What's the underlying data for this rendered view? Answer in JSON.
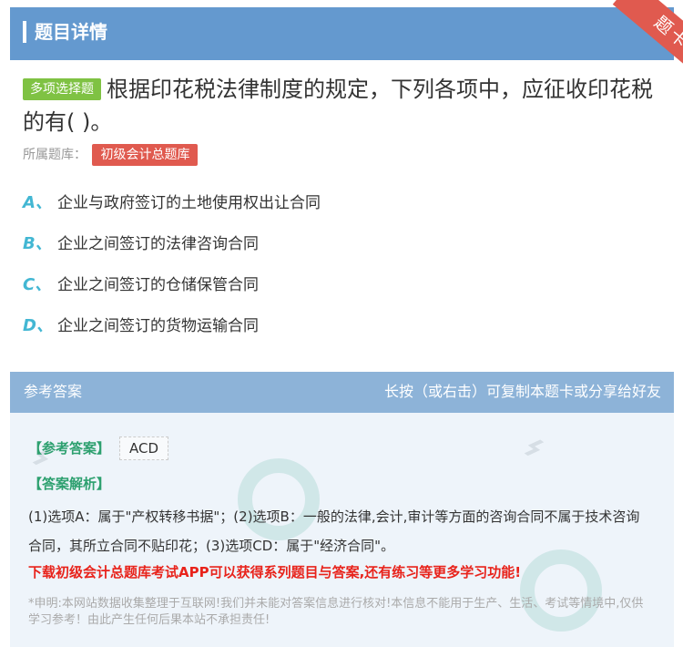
{
  "header": {
    "title": "题目详情"
  },
  "ribbon": {
    "label": "题卡"
  },
  "question": {
    "type_tag": "多项选择题",
    "text": "根据印花税法律制度的规定，下列各项中，应征收印花税的有( )。",
    "bank_label": "所属题库：",
    "bank_name": "初级会计总题库",
    "options": [
      {
        "letter": "A、",
        "text": "企业与政府签订的土地使用权出让合同"
      },
      {
        "letter": "B、",
        "text": "企业之间签订的法律咨询合同"
      },
      {
        "letter": "C、",
        "text": "企业之间签订的仓储保管合同"
      },
      {
        "letter": "D、",
        "text": "企业之间签订的货物运输合同"
      }
    ]
  },
  "answer": {
    "section_title": "参考答案",
    "copy_hint": "长按（或右击）可复制本题卡或分享给好友",
    "ref_label": "【参考答案】",
    "ref_value": "ACD",
    "analysis_label": "【答案解析】",
    "analysis_text": "(1)选项A：属于\"产权转移书据\"；(2)选项B：一般的法律,会计,审计等方面的咨询合同不属于技术咨询合同，其所立合同不贴印花；(3)选项CD：属于\"经济合同\"。",
    "promo": "下载初级会计总题库考试APP可以获得系列题目与答案,还有练习等更多学习功能!",
    "disclaimer": "*申明:本网站数据收集整理于互联网!我们并未能对答案信息进行核对!本信息不能用于生产、生活、考试等情境中,仅供学习参考！由此产生任何后果本站不承担责任!"
  },
  "colors": {
    "header_bg": "#6499cf",
    "ribbon_bg": "#e05a4f",
    "type_tag_bg": "#7fc243",
    "bank_badge_bg": "#e05a4f",
    "option_letter": "#43b7d3",
    "answer_header_bg": "#8db3d8",
    "answer_label": "#2da06f",
    "promo_text": "#e8231b"
  }
}
